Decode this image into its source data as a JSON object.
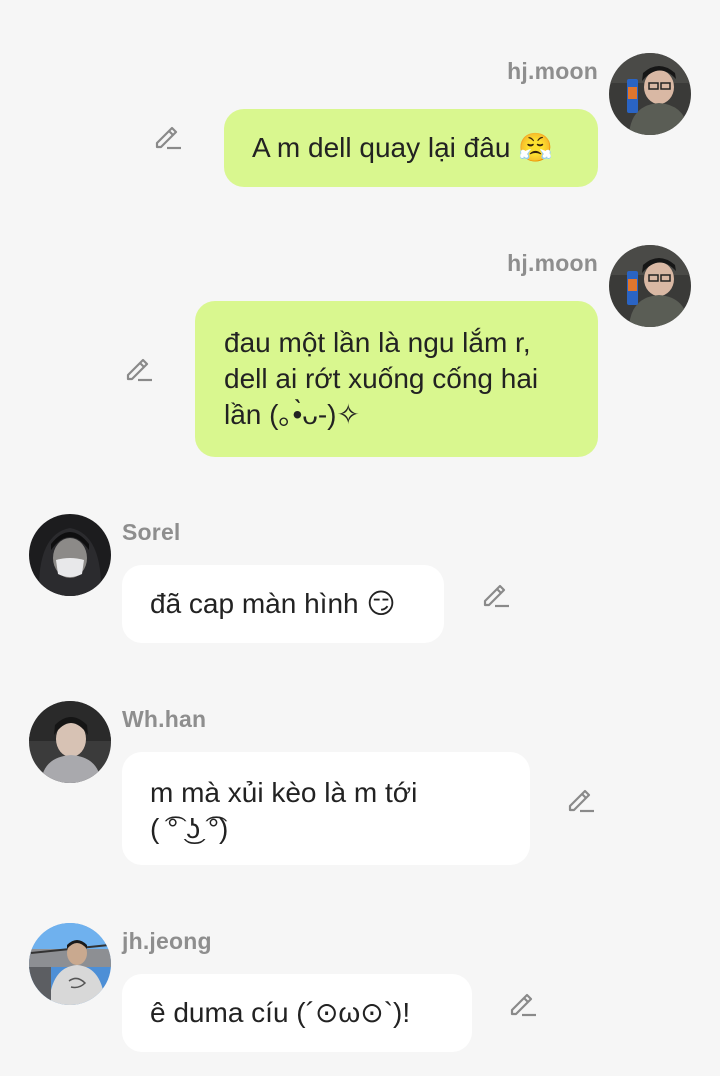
{
  "messages": [
    {
      "sender": "hj.moon",
      "text": "A m dell quay lại đâu 😤",
      "direction": "outgoing"
    },
    {
      "sender": "hj.moon",
      "text": "đau một lần là ngu lắm r,\ndell ai rớt xuống cống hai\nlần (｡•̀ᴗ-)✧",
      "direction": "outgoing"
    },
    {
      "sender": "Sorel",
      "text": "đã cap màn hình 😏",
      "direction": "incoming"
    },
    {
      "sender": "Wh.han",
      "text": "m mà xủi kèo là m tới\n( ͡° ͜ʖ ͡°)",
      "direction": "incoming"
    },
    {
      "sender": "jh.jeong",
      "text": "ê duma cíu (´⊙ω⊙`)!",
      "direction": "incoming"
    }
  ],
  "colors": {
    "background": "#f6f6f6",
    "outgoing_bubble": "#d9f78f",
    "incoming_bubble": "#ffffff",
    "sender_name": "#8e8e8e",
    "message_text": "#222222"
  },
  "icons": {
    "edit": "pencil-icon"
  }
}
